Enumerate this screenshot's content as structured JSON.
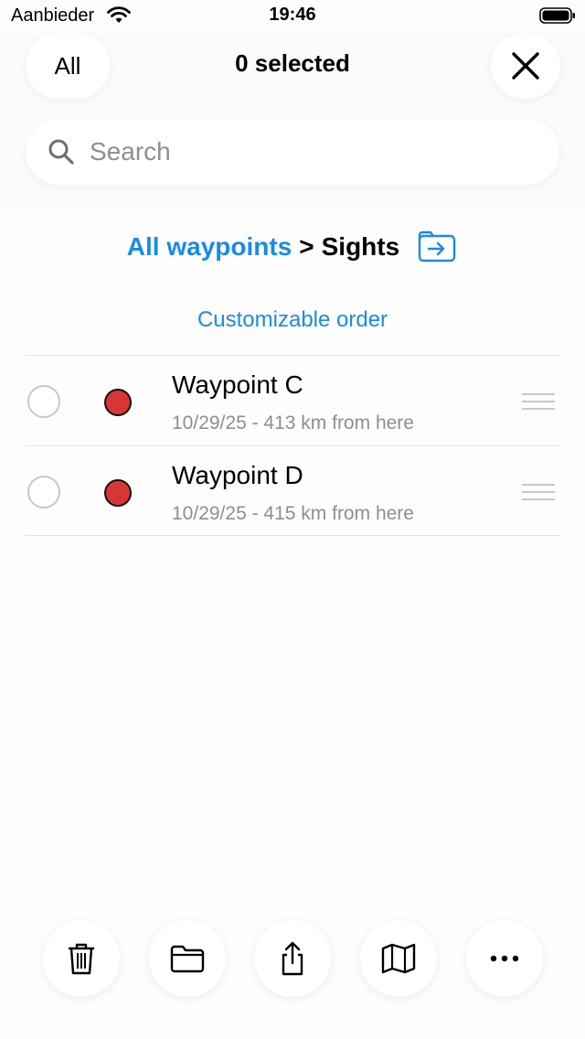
{
  "status_bar": {
    "carrier": "Aanbieder",
    "time": "19:46"
  },
  "header": {
    "all_label": "All",
    "selected_label": "0 selected"
  },
  "search": {
    "placeholder": "Search"
  },
  "breadcrumb": {
    "root": "All waypoints",
    "separator": ">",
    "current": "Sights"
  },
  "order_label": "Customizable order",
  "waypoints": [
    {
      "title": "Waypoint C",
      "subtitle": "10/29/25 - 413 km from here",
      "color": "#d93535"
    },
    {
      "title": "Waypoint D",
      "subtitle": "10/29/25 - 415 km from here",
      "color": "#d93535"
    }
  ],
  "toolbar": {
    "icons": [
      "trash-icon",
      "folder-icon",
      "share-icon",
      "map-icon",
      "more-icon"
    ]
  },
  "colors": {
    "accent": "#1a8ae8",
    "pin": "#d93535"
  }
}
